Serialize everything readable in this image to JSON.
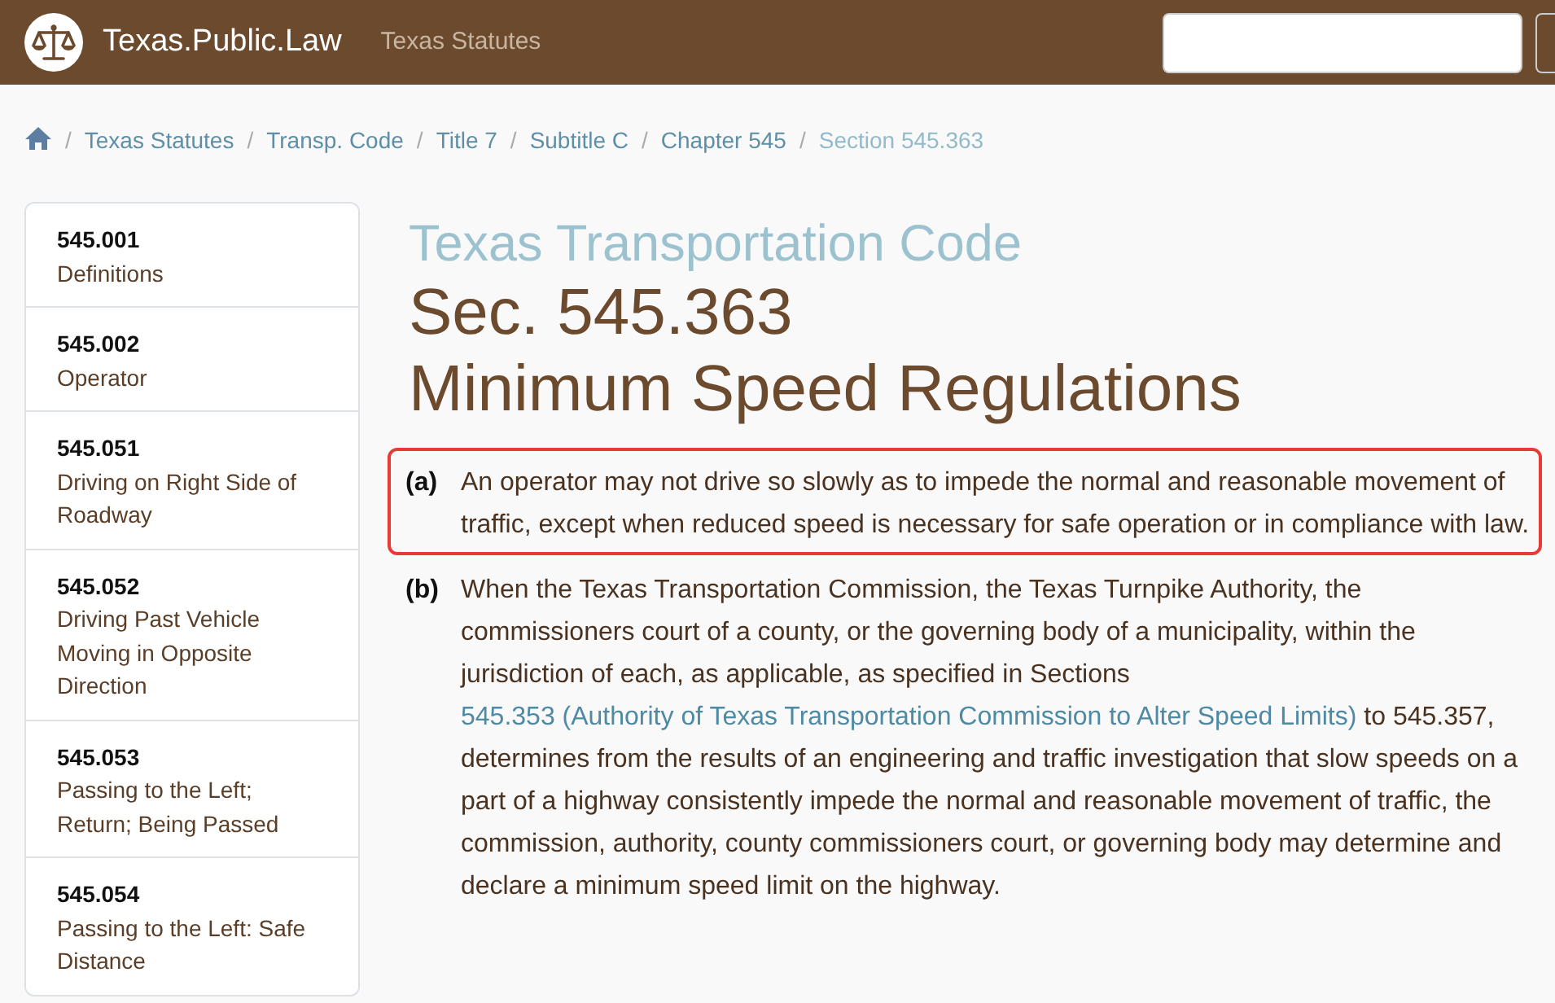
{
  "site": {
    "name": "Texas.Public.Law",
    "nav_link": "Texas Statutes"
  },
  "breadcrumb": [
    {
      "separator": "/",
      "label": "Texas Statutes",
      "selected": false
    },
    {
      "separator": "/",
      "label": "Transp. Code",
      "selected": false
    },
    {
      "separator": "/",
      "label": "Title 7",
      "selected": false
    },
    {
      "separator": "/",
      "label": "Subtitle C",
      "selected": false
    },
    {
      "separator": "/",
      "label": "Chapter 545",
      "selected": false
    },
    {
      "separator": "/",
      "label": "Section 545.363",
      "selected": true
    }
  ],
  "sidebar": {
    "items": [
      {
        "number": "545.001",
        "title": "Definitions"
      },
      {
        "number": "545.002",
        "title": "Operator"
      },
      {
        "number": "545.051",
        "title": "Driving on Right Side of Roadway"
      },
      {
        "number": "545.052",
        "title": "Driving Past Vehicle Moving in Opposite Direction"
      },
      {
        "number": "545.053",
        "title": "Passing to the Left; Return; Being Passed"
      },
      {
        "number": "545.054",
        "title": "Passing to the Left: Safe Distance"
      }
    ]
  },
  "heading": {
    "code": "Texas Transportation Code",
    "section": "Sec. 545.363",
    "title": "Minimum Speed Regulations"
  },
  "subsections": [
    {
      "label": "(a)",
      "highlighted": true,
      "text": "An operator may not drive so slowly as to impede the normal and reasonable movement of traffic, except when reduced speed is necessary for safe operation or in compliance with law."
    },
    {
      "label": "(b)",
      "highlighted": false,
      "text": "When the Texas Transportation Commission, the Texas Turnpike Authority, the commissioners court of a county, or the governing body of a municipality, within the jurisdiction of each, as applicable, as specified in Sections",
      "link": "545.353 (Authority of Texas Transportation Commission to Alter Speed Limits)",
      "text_after": "to 545.357, determines from the results of an engineering and traffic investigation that slow speeds on a part of a highway consistently impede the normal and reasonable movement of traffic, the commission, authority, county commissioners court, or governing body may determine and declare a minimum speed limit on the highway."
    }
  ]
}
